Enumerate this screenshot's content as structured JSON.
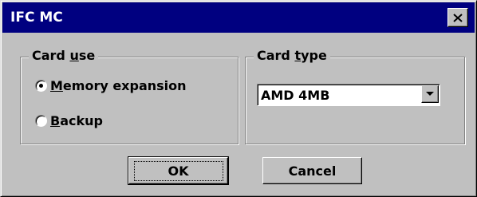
{
  "window": {
    "title": "IFC MC"
  },
  "card_use": {
    "label_pre": "Card ",
    "label_accel": "u",
    "label_post": "se",
    "options": [
      {
        "accel": "M",
        "rest": "emory expansion",
        "selected": true
      },
      {
        "accel": "B",
        "rest": "ackup",
        "selected": false
      }
    ]
  },
  "card_type": {
    "label_pre": "Card ",
    "label_accel": "t",
    "label_post": "ype",
    "selected_value": "AMD 4MB"
  },
  "buttons": {
    "ok_label": "OK",
    "cancel_label": "Cancel"
  },
  "icons": {
    "close": "close-icon",
    "dropdown": "chevron-down-icon"
  },
  "colors": {
    "titlebar": "#000080",
    "face": "#c0c0c0"
  }
}
